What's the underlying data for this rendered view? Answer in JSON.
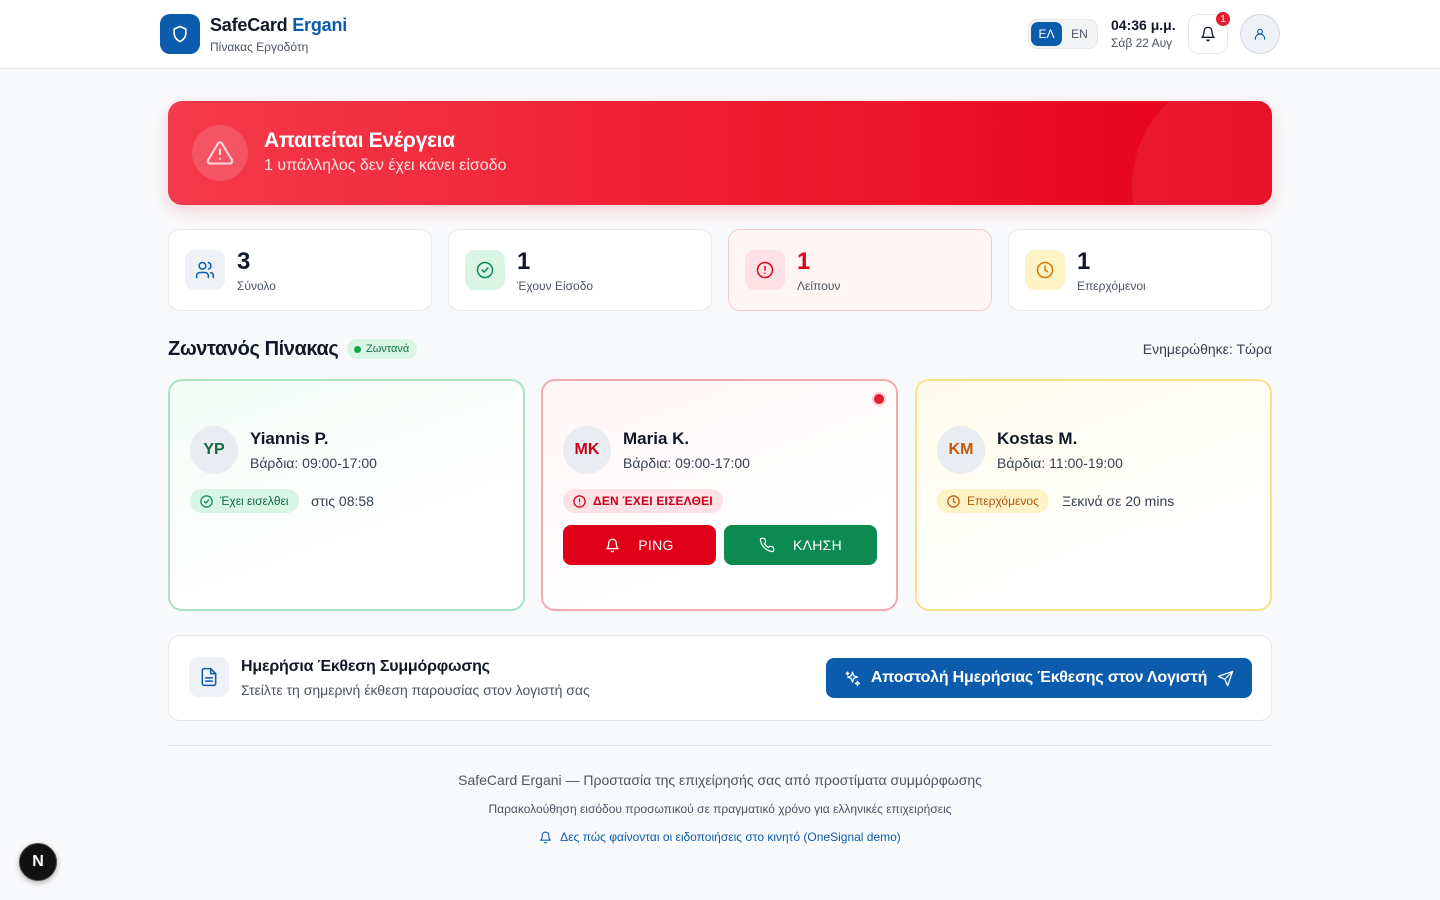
{
  "header": {
    "brand_main": "SafeCard",
    "brand_accent": "Ergani",
    "subtitle": "Πίνακας Εργοδότη",
    "lang_options": [
      "ΕΛ",
      "EN"
    ],
    "lang_selected": "ΕΛ",
    "time": "04:36 μ.μ.",
    "date": "Σάβ 22 Αυγ",
    "notification_count": "1"
  },
  "alert": {
    "title": "Απαιτείται Ενέργεια",
    "message": "1 υπάλληλος δεν έχει κάνει είσοδο"
  },
  "stats": [
    {
      "value": "3",
      "label": "Σύνολο",
      "icon": "users-icon"
    },
    {
      "value": "1",
      "label": "Έχουν Είσοδο",
      "icon": "check-circle-icon"
    },
    {
      "value": "1",
      "label": "Λείπουν",
      "icon": "alert-circle-icon"
    },
    {
      "value": "1",
      "label": "Επερχόμενοι",
      "icon": "clock-icon"
    }
  ],
  "board": {
    "title": "Ζωντανός Πίνακας",
    "live_label": "Ζωντανά",
    "updated": "Ενημερώθηκε: Τώρα"
  },
  "employees": [
    {
      "initials": "YP",
      "name": "Yiannis P.",
      "shift": "Βάρδια: 09:00-17:00",
      "status": "Έχει εισελθει",
      "note": "στις 08:58",
      "state": "checked-in"
    },
    {
      "initials": "MK",
      "name": "Maria K.",
      "shift": "Βάρδια: 09:00-17:00",
      "status": "ΔΕΝ ΈΧΕΙ ΕΙΣΕΛΘΕΙ",
      "note": "",
      "state": "missing",
      "ping_label": "PING",
      "call_label": "ΚΛΗΣΗ"
    },
    {
      "initials": "KM",
      "name": "Kostas M.",
      "shift": "Βάρδια: 11:00-19:00",
      "status": "Επερχόμενος",
      "note": "Ξεκινά σε 20 mins",
      "state": "upcoming"
    }
  ],
  "report": {
    "title": "Ημερήσια Έκθεση Συμμόρφωσης",
    "subtitle": "Στείλτε τη σημερινή έκθεση παρουσίας στον λογιστή σας",
    "button_label": "Αποστολή Ημερήσιας Έκθεσης στον Λογιστή"
  },
  "footer": {
    "line1": "SafeCard Ergani — Προστασία της επιχείρησής σας από προστίματα συμμόρφωσης",
    "line2": "Παρακολούθηση εισόδου προσωπικού σε πραγματικό χρόνο για ελληνικές επιχειρήσεις",
    "link": "Δες πώς φαίνονται οι ειδοποιήσεις στο κινητό (OneSignal demo)"
  },
  "dev_badge": "N",
  "colors": {
    "brand": "#0b5cad",
    "danger": "#e0001a",
    "success": "#0d8a50",
    "warning": "#d97706"
  }
}
